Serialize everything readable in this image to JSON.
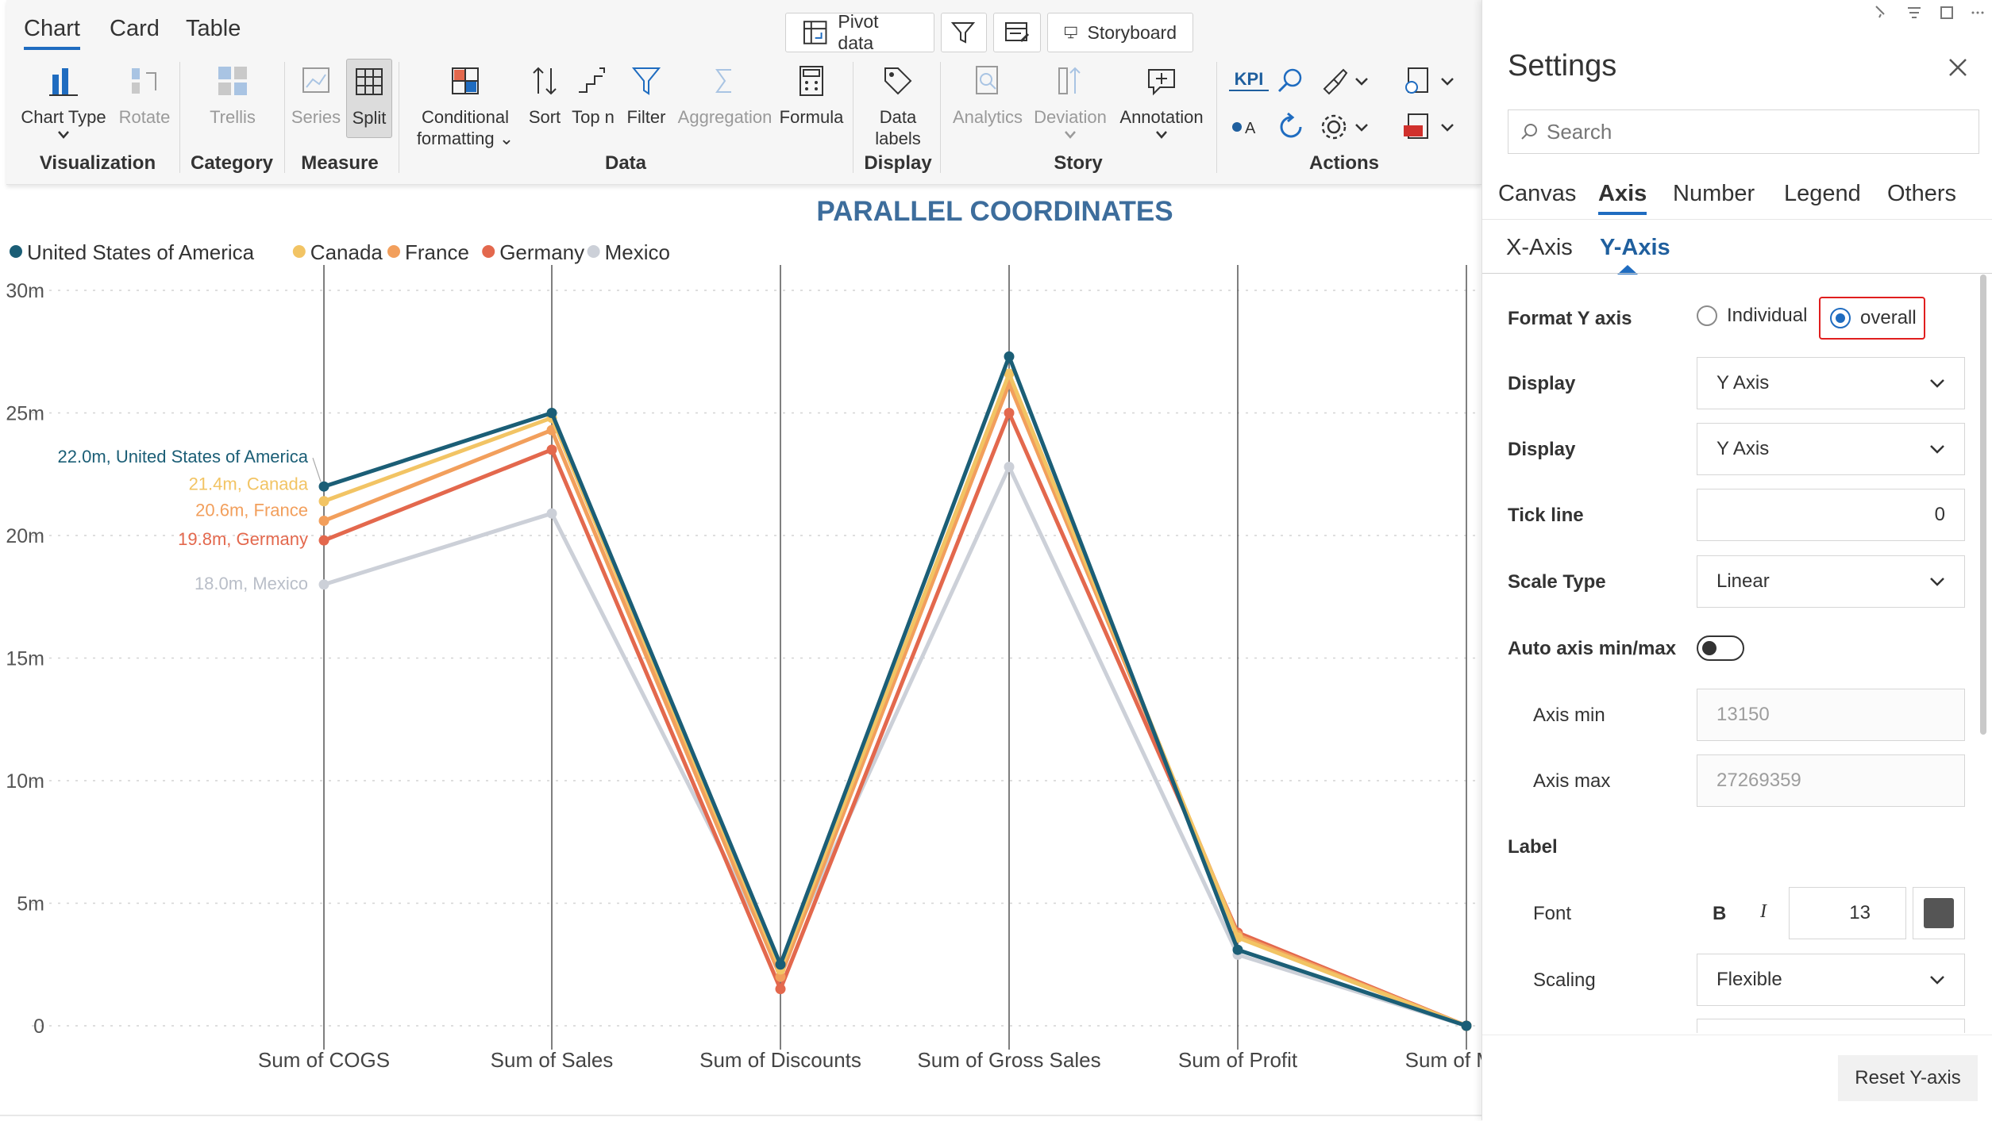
{
  "ribbon": {
    "tabs": [
      "Chart",
      "Card",
      "Table"
    ],
    "active_tab": "Chart",
    "top_buttons": {
      "pivot": "Pivot data",
      "storyboard": "Storyboard"
    },
    "buttons": {
      "chart_type": "Chart Type",
      "rotate": "Rotate",
      "trellis": "Trellis",
      "series": "Series",
      "split": "Split",
      "conditional_1": "Conditional",
      "conditional_2": "formatting",
      "sort": "Sort",
      "top_n": "Top n",
      "filter": "Filter",
      "aggregation": "Aggregation",
      "formula": "Formula",
      "data_labels_1": "Data",
      "data_labels_2": "labels",
      "analytics": "Analytics",
      "deviation": "Deviation",
      "annotation": "Annotation",
      "kpi": "KPI"
    },
    "groups": {
      "visualization": "Visualization",
      "category": "Category",
      "measure": "Measure",
      "data": "Data",
      "display": "Display",
      "story": "Story",
      "actions": "Actions"
    }
  },
  "chart_data": {
    "type": "line",
    "title": "PARALLEL COORDINATES",
    "categories": [
      "Sum of COGS",
      "Sum of Sales",
      "Sum of Discounts",
      "Sum of Gross Sales",
      "Sum of Profit",
      "Sum of Manu"
    ],
    "y_ticks": [
      "0",
      "5m",
      "10m",
      "15m",
      "20m",
      "25m",
      "30m"
    ],
    "ylim": [
      0,
      30
    ],
    "y_unit": "m",
    "grid": true,
    "legend_position": "top-left",
    "series": [
      {
        "name": "United States of America",
        "color": "#1b5e76",
        "values": [
          22.0,
          25.0,
          2.5,
          27.3,
          3.1,
          0.0
        ],
        "label": "22.0m, United States of America"
      },
      {
        "name": "Canada",
        "color": "#f2c464",
        "values": [
          21.4,
          24.8,
          2.3,
          26.6,
          3.6,
          0.0
        ],
        "label": "21.4m, Canada"
      },
      {
        "name": "France",
        "color": "#f29f5c",
        "values": [
          20.6,
          24.3,
          2.0,
          26.2,
          3.7,
          0.0
        ],
        "label": "20.6m, France"
      },
      {
        "name": "Germany",
        "color": "#e3684d",
        "values": [
          19.8,
          23.5,
          1.5,
          25.0,
          3.8,
          0.0
        ],
        "label": "19.8m, Germany"
      },
      {
        "name": "Mexico",
        "color": "#ccd0d8",
        "values": [
          18.0,
          20.9,
          2.4,
          22.8,
          2.9,
          0.0
        ],
        "label": "18.0m, Mexico"
      }
    ]
  },
  "settings": {
    "title": "Settings",
    "search_placeholder": "Search",
    "tabs": [
      "Canvas",
      "Axis",
      "Number",
      "Legend",
      "Others"
    ],
    "active_tab": "Axis",
    "subtabs": [
      "X-Axis",
      "Y-Axis"
    ],
    "active_subtab": "Y-Axis",
    "format_y_axis": {
      "label": "Format Y axis",
      "options": [
        "Individual",
        "overall"
      ],
      "selected": "overall"
    },
    "display1": {
      "label": "Display",
      "value": "Y Axis"
    },
    "display2": {
      "label": "Display",
      "value": "Y Axis"
    },
    "tick_line": {
      "label": "Tick line",
      "value": "0"
    },
    "scale_type": {
      "label": "Scale Type",
      "value": "Linear"
    },
    "auto_axis": {
      "label": "Auto axis min/max",
      "on": false
    },
    "axis_min": {
      "label": "Axis min",
      "value": "13150"
    },
    "axis_max": {
      "label": "Axis max",
      "value": "27269359"
    },
    "label_section": "Label",
    "font": {
      "label": "Font",
      "bold": "B",
      "italic": "I",
      "size": "13",
      "color": "#555555"
    },
    "scaling": {
      "label": "Scaling",
      "value": "Flexible"
    },
    "reset_button": "Reset Y-axis"
  }
}
